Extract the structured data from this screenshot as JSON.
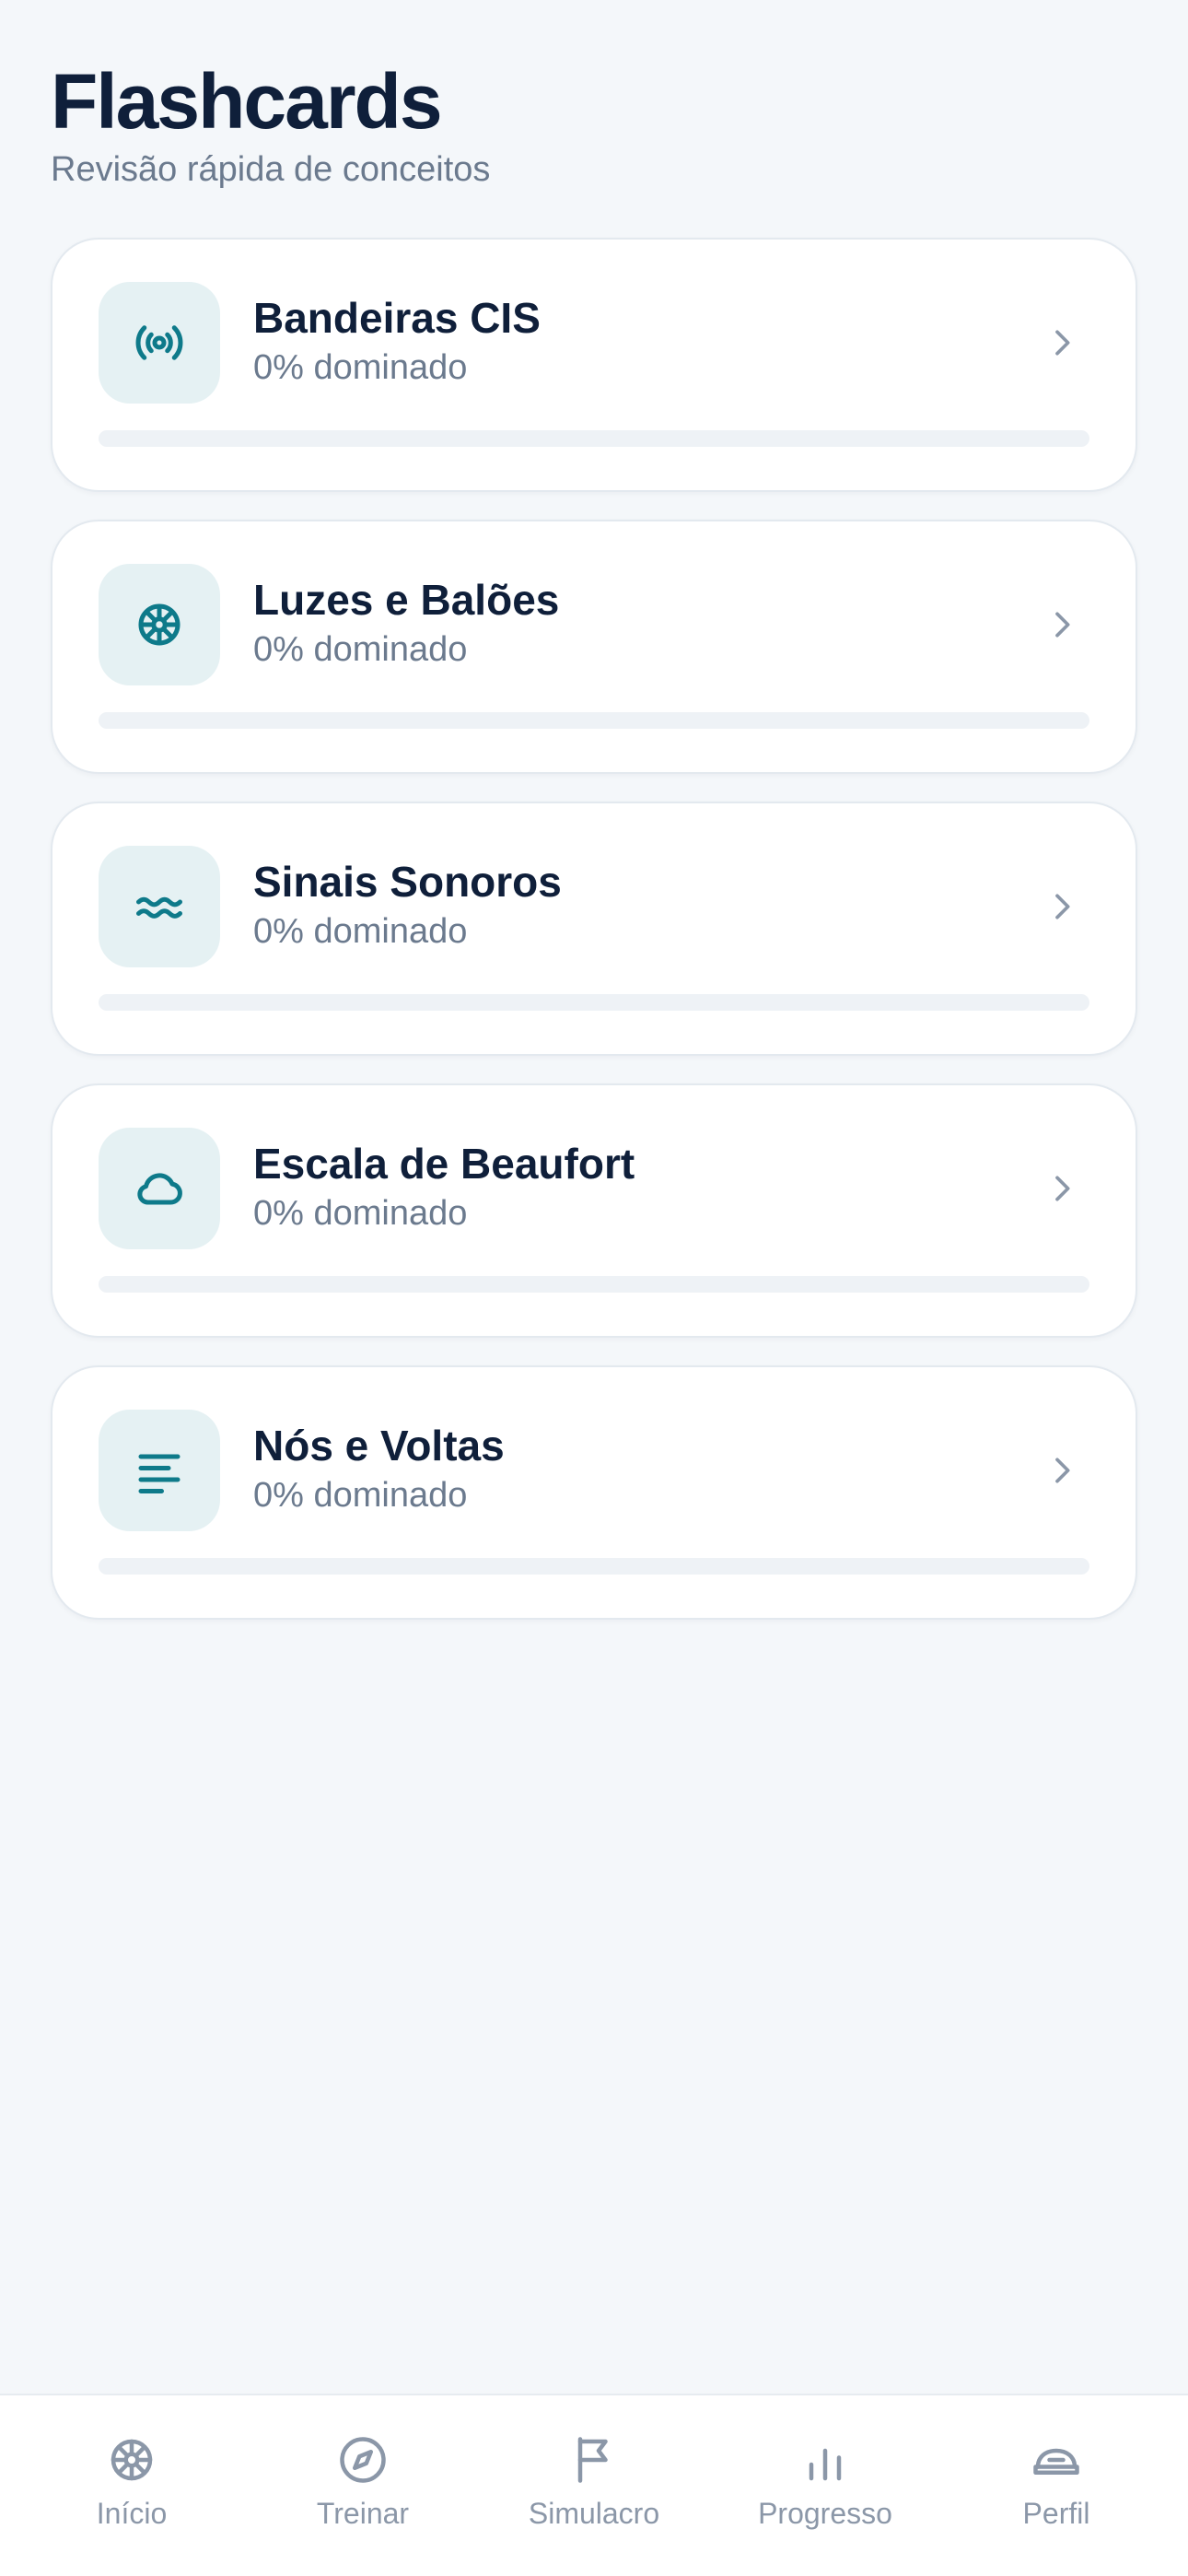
{
  "header": {
    "title": "Flashcards",
    "subtitle": "Revisão rápida de conceitos"
  },
  "colors": {
    "accent": "#0e7a8a",
    "icon_bg": "#e5f1f3",
    "text_primary": "#0f1f3a",
    "text_secondary": "#6b7a8e",
    "tab_inactive": "#8b97a8"
  },
  "cards": [
    {
      "title": "Bandeiras CIS",
      "progress_text": "0% dominado",
      "progress": 0,
      "icon": "radio-broadcast-icon"
    },
    {
      "title": "Luzes e Balões",
      "progress_text": "0% dominado",
      "progress": 0,
      "icon": "ship-wheel-icon"
    },
    {
      "title": "Sinais Sonoros",
      "progress_text": "0% dominado",
      "progress": 0,
      "icon": "waves-icon"
    },
    {
      "title": "Escala de Beaufort",
      "progress_text": "0% dominado",
      "progress": 0,
      "icon": "cloud-icon"
    },
    {
      "title": "Nós e Voltas",
      "progress_text": "0% dominado",
      "progress": 0,
      "icon": "text-lines-icon"
    }
  ],
  "tabs": [
    {
      "label": "Início",
      "icon": "ship-wheel-icon"
    },
    {
      "label": "Treinar",
      "icon": "compass-icon"
    },
    {
      "label": "Simulacro",
      "icon": "flag-icon"
    },
    {
      "label": "Progresso",
      "icon": "bar-chart-icon"
    },
    {
      "label": "Perfil",
      "icon": "captain-hat-icon"
    }
  ]
}
